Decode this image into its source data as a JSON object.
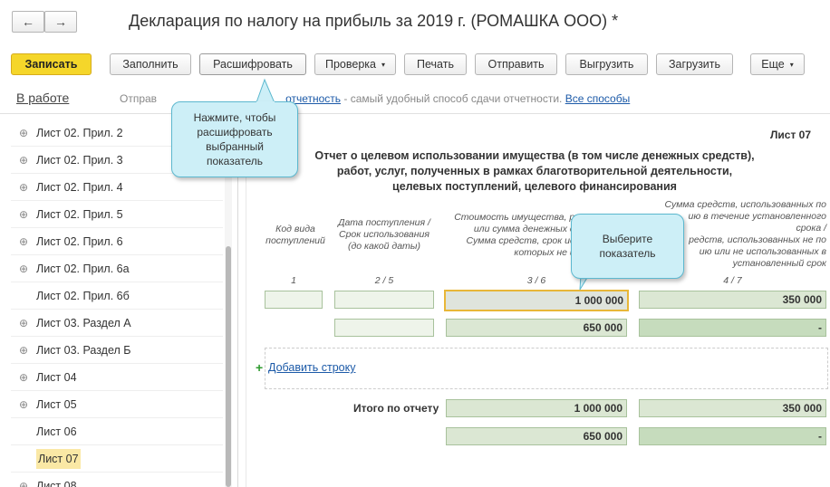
{
  "window": {
    "title": "Декларация по налогу на прибыль за 2019 г. (РОМАШКА ООО) *",
    "back": "←",
    "forward": "→"
  },
  "toolbar": {
    "save": "Записать",
    "fill": "Заполнить",
    "decode": "Расшифровать",
    "check": "Проверка",
    "print": "Печать",
    "send": "Отправить",
    "export": "Выгрузить",
    "import": "Загрузить",
    "more": "Еще",
    "caret": "▾"
  },
  "status": {
    "state": "В работе",
    "text_prefix": "Отправ",
    "link1": "отчетность",
    "text_middle": " - самый удобный способ сдачи отчетности. ",
    "link2": "Все способы"
  },
  "sidebar": {
    "items": [
      {
        "label": "Лист 02. Прил. 2",
        "expander": "⊕"
      },
      {
        "label": "Лист 02. Прил. 3",
        "expander": "⊕"
      },
      {
        "label": "Лист 02. Прил. 4",
        "expander": "⊕"
      },
      {
        "label": "Лист 02. Прил. 5",
        "expander": "⊕"
      },
      {
        "label": "Лист 02. Прил. 6",
        "expander": "⊕"
      },
      {
        "label": "Лист 02. Прил. 6а",
        "expander": "⊕"
      },
      {
        "label": "Лист 02. Прил. 6б",
        "expander": ""
      },
      {
        "label": "Лист 03. Раздел А",
        "expander": "⊕"
      },
      {
        "label": "Лист 03. Раздел Б",
        "expander": "⊕"
      },
      {
        "label": "Лист 04",
        "expander": "⊕"
      },
      {
        "label": "Лист 05",
        "expander": "⊕"
      },
      {
        "label": "Лист 06",
        "expander": ""
      },
      {
        "label": "Лист 07",
        "expander": "",
        "active": true
      },
      {
        "label": "Лист 08",
        "expander": "⊕"
      }
    ]
  },
  "report": {
    "sheet": "Лист 07",
    "title_lines": [
      "Отчет о целевом использовании имущества (в том числе денежных средств),",
      "работ, услуг, полученных в рамках благотворительной деятельности,",
      "целевых поступлений, целевого финансирования"
    ],
    "col1_head": [
      "Код вида",
      "поступлений"
    ],
    "col2_head": [
      "Дата поступления /",
      "Срок использования",
      "(до какой даты)"
    ],
    "col3_head": [
      "Стоимость имущества, ра",
      "или сумма денежных ср",
      "Сумма средств, срок исп",
      "которых не ис"
    ],
    "col4_head": [
      "Сумма средств, использованных по",
      "ию в течение установленного",
      "срока /",
      "редств, использованных не по",
      "ию или не использованных в",
      "установленный срок"
    ],
    "col_nums": [
      "1",
      "2 / 5",
      "3 / 6",
      "4 / 7"
    ],
    "row1": {
      "c3": "1 000 000",
      "c4": "350 000"
    },
    "row2": {
      "c3": "650 000",
      "c4": "-"
    },
    "add_plus": "+",
    "add_row": "Добавить строку",
    "total_label": "Итого по отчету",
    "total1": {
      "c3": "1 000 000",
      "c4": "350 000"
    },
    "total2": {
      "c3": "650 000",
      "c4": "-"
    }
  },
  "callouts": {
    "decode_hint": [
      "Нажмите, чтобы",
      "расшифровать",
      "выбранный",
      "показатель"
    ],
    "select_hint": [
      "Выберите",
      "показатель"
    ]
  },
  "colors": {
    "primary_button": "#f5d62a",
    "callout_bg": "#cdeff7",
    "cell_bg": "#dbe7d3",
    "selected_border": "#e8b738",
    "link": "#1c5aa8"
  }
}
